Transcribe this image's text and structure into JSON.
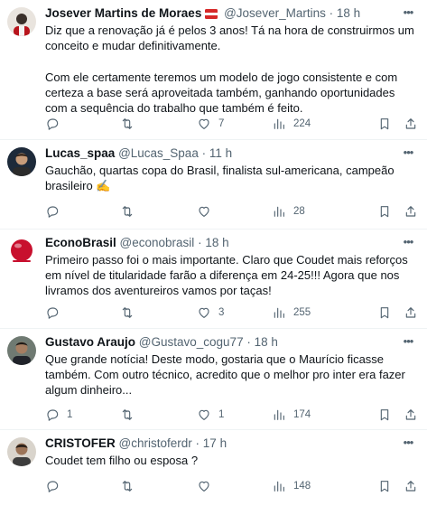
{
  "tweets": [
    {
      "name": "Josever Martins de Moraes",
      "handle": "@Josever_Martins",
      "sep": "·",
      "time": "18 h",
      "text": "Diz que a renovação já é pelos 3 anos! Tá na hora de construirmos um conceito e mudar definitivamente.\n\nCom ele certamente teremos um modelo de jogo consistente e com certeza a base será aproveitada também, ganhando oportunidades com a sequência do trabalho que também é feito.",
      "replies": "",
      "retweets": "",
      "likes": "7",
      "views": "224"
    },
    {
      "name": "Lucas_spaa",
      "handle": "@Lucas_Spaa",
      "sep": "·",
      "time": "11 h",
      "text": "Gauchão, quartas copa do Brasil, finalista sul-americana, campeão brasileiro ✍️",
      "replies": "",
      "retweets": "",
      "likes": "",
      "views": "28"
    },
    {
      "name": "EconoBrasil",
      "handle": "@econobrasil",
      "sep": "·",
      "time": "18 h",
      "text": "Primeiro passo foi o mais importante. Claro que Coudet mais reforços em nível de titularidade farão a diferença em 24-25!!! Agora que nos livramos dos aventureiros vamos por taças!",
      "replies": "",
      "retweets": "",
      "likes": "3",
      "views": "255"
    },
    {
      "name": "Gustavo Araujo",
      "handle": "@Gustavo_cogu77",
      "sep": "·",
      "time": "18 h",
      "text": "Que grande notícia! Deste modo, gostaria que o Maurício ficasse também. Com outro técnico, acredito que o melhor pro inter era fazer algum dinheiro...",
      "replies": "1",
      "retweets": "",
      "likes": "1",
      "views": "174"
    },
    {
      "name": "CRISTOFER",
      "handle": "@christoferdr",
      "sep": "·",
      "time": "17 h",
      "text": "Coudet tem filho ou esposa ?",
      "replies": "",
      "retweets": "",
      "likes": "",
      "views": "148"
    }
  ],
  "icons": {
    "menu": "more-horizontal-icon",
    "reply": "reply-icon",
    "retweet": "retweet-icon",
    "like": "heart-icon",
    "views": "views-chart-icon",
    "bookmark": "bookmark-icon",
    "share": "share-icon"
  },
  "colors": {
    "text": "#0f1419",
    "secondary": "#536471",
    "divider": "#eff3f4",
    "flag_red": "#d62828"
  }
}
